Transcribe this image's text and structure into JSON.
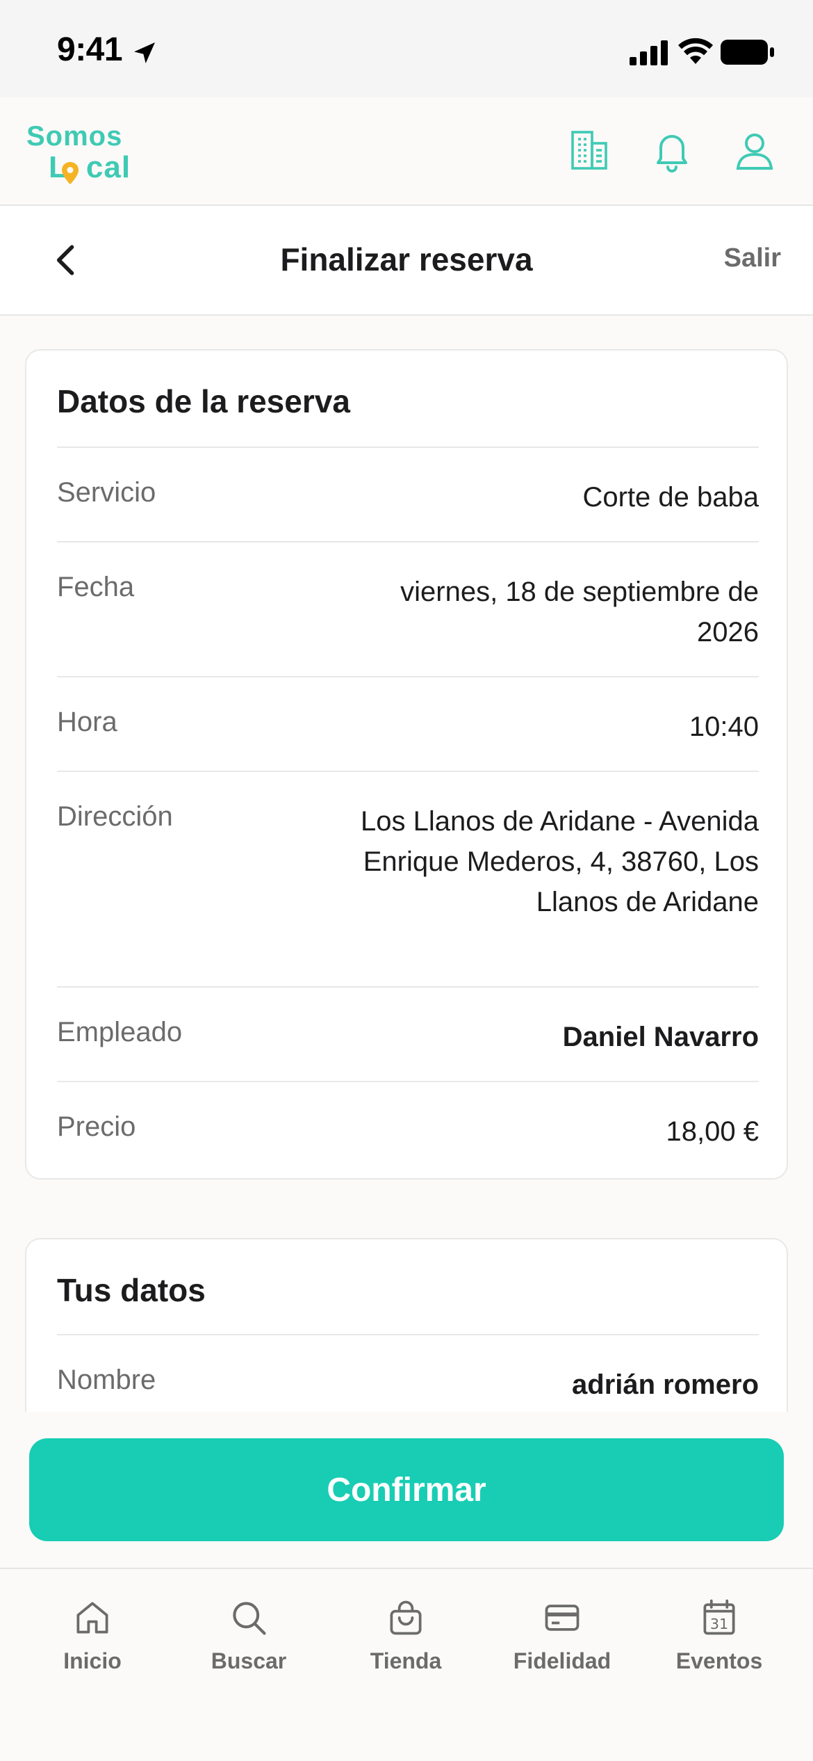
{
  "status_bar": {
    "time": "9:41"
  },
  "brand": {
    "line1": "Somos",
    "line2_a": "L",
    "line2_b": "cal",
    "accent": "#3fcab4",
    "pin_color": "#f5b324"
  },
  "navbar": {
    "title": "Finalizar reserva",
    "exit_label": "Salir"
  },
  "booking": {
    "title": "Datos de la reserva",
    "rows": [
      {
        "label": "Servicio",
        "value": "Corte de baba"
      },
      {
        "label": "Fecha",
        "value": "viernes, 18 de septiembre de 2026"
      },
      {
        "label": "Hora",
        "value": "10:40"
      },
      {
        "label": "Dirección",
        "value": "Los Llanos de Aridane - Avenida Enrique Mederos, 4, 38760, Los Llanos de Aridane"
      },
      {
        "label": "Empleado",
        "value": "Daniel Navarro"
      },
      {
        "label": "Precio",
        "value": "18,00 €"
      }
    ]
  },
  "your_data": {
    "title": "Tus datos",
    "rows": [
      {
        "label": "Nombre",
        "value": "adrián romero"
      }
    ]
  },
  "confirm": {
    "label": "Confirmar",
    "color": "#18cdb4"
  },
  "tabs": [
    {
      "label": "Inicio",
      "icon": "home-icon"
    },
    {
      "label": "Buscar",
      "icon": "search-icon"
    },
    {
      "label": "Tienda",
      "icon": "bag-icon"
    },
    {
      "label": "Fidelidad",
      "icon": "card-icon"
    },
    {
      "label": "Eventos",
      "icon": "calendar-icon",
      "calendar_day": "31"
    }
  ]
}
